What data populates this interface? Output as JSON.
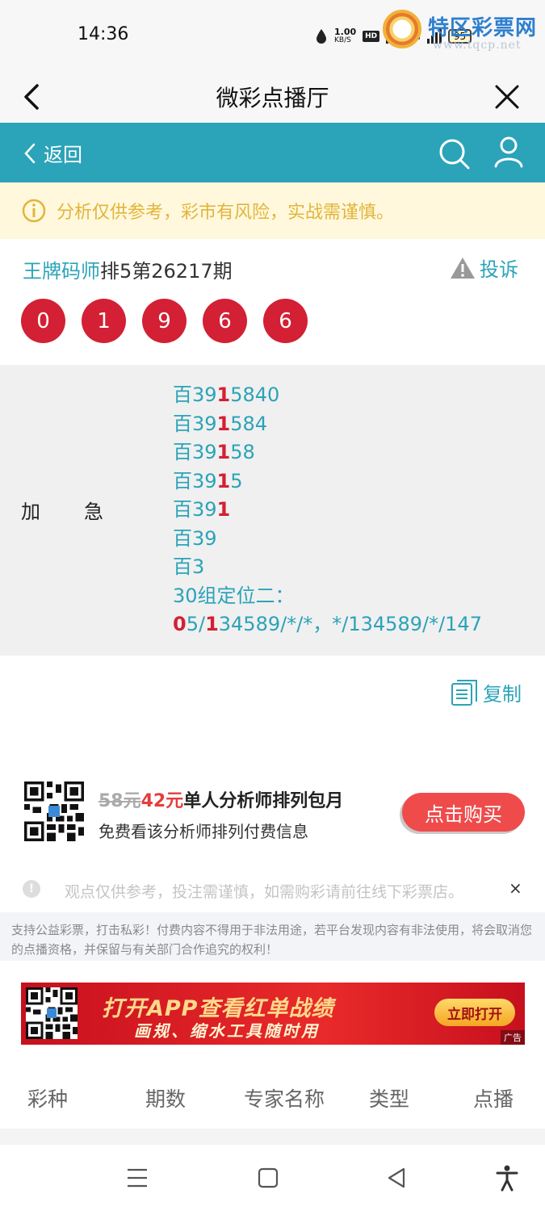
{
  "status_bar": {
    "time": "14:36",
    "net_speed": "1.00",
    "net_unit": "KB/S",
    "hd_label": "HD",
    "network": "5G",
    "battery": "95"
  },
  "watermark": {
    "title": "特区彩票网",
    "url": "www.tqcp.net"
  },
  "titlebar": {
    "title": "微彩点播厅"
  },
  "nav": {
    "back_label": "返回"
  },
  "notice": {
    "text": "分析仅供参考，彩市有风险，实战需谨慎。"
  },
  "expert": {
    "name": "王牌码师",
    "issue": "排5第26217期",
    "complain_label": "投诉"
  },
  "balls": [
    "0",
    "1",
    "9",
    "6",
    "6"
  ],
  "prediction": {
    "label_a": "加",
    "label_b": "急",
    "lines": [
      {
        "pre": "百39",
        "hit": "1",
        "post": "5840"
      },
      {
        "pre": "百39",
        "hit": "1",
        "post": "584"
      },
      {
        "pre": "百39",
        "hit": "1",
        "post": "58"
      },
      {
        "pre": "百39",
        "hit": "1",
        "post": "5"
      },
      {
        "pre": "百39",
        "hit": "1",
        "post": ""
      },
      {
        "pre": "百39",
        "hit": "",
        "post": ""
      },
      {
        "pre": "百3",
        "hit": "",
        "post": ""
      },
      {
        "pre": "30组定位二：",
        "hit": "",
        "post": ""
      }
    ],
    "last_line": {
      "hit1": "0",
      "mid1": "5/",
      "hit2": "1",
      "rest": "34589/*/*，*/134589/*/147"
    }
  },
  "copy_label": "复制",
  "purchase": {
    "old_price": "58元",
    "new_price": "42元",
    "title": "单人分析师排列包月",
    "subtitle": "免费看该分析师排列付费信息",
    "button": "点击购买"
  },
  "disclaimer": {
    "short": "观点仅供参考，投注需谨慎，如需购彩请前往线下彩票店。",
    "close": "×",
    "long": "支持公益彩票，打击私彩！付费内容不得用于非法用途，若平台发现内容有非法使用，将会取消您的点播资格，并保留与有关部门合作追究的权利！"
  },
  "banner": {
    "line1": "打开APP查看红单战绩",
    "line2": "画规、缩水工具随时用",
    "button": "立即打开",
    "ad_tag": "广告"
  },
  "table_header": [
    "彩种",
    "期数",
    "专家名称",
    "类型",
    "点播"
  ],
  "colors": {
    "teal": "#2ba3b8",
    "red": "#d32034",
    "notice_bg": "#fff8dd",
    "notice_text": "#e2b53a"
  }
}
